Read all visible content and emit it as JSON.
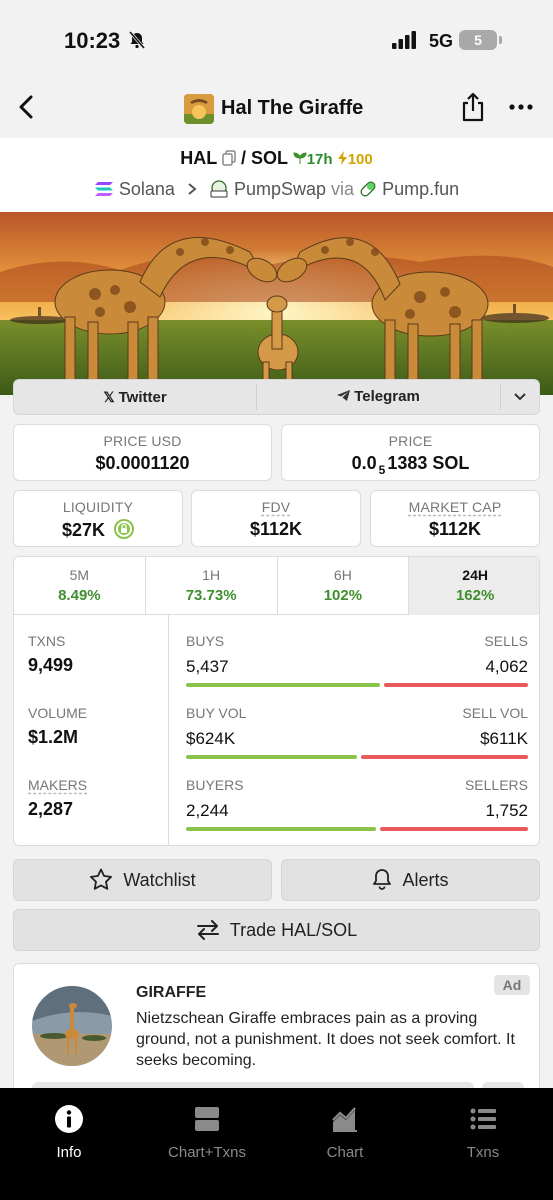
{
  "status_bar": {
    "time": "10:23",
    "network": "5G",
    "battery": "5"
  },
  "nav": {
    "title": "Hal The Giraffe"
  },
  "pair": {
    "base": "HAL",
    "separator": "/",
    "quote": "SOL",
    "age": "17h",
    "boosts": "100",
    "chain": "Solana",
    "dex": "PumpSwap",
    "via": "via",
    "launchpad": "Pump.fun"
  },
  "socials": {
    "twitter": "Twitter",
    "telegram": "Telegram"
  },
  "price_usd": {
    "label": "PRICE USD",
    "value": "$0.0001120"
  },
  "price_native": {
    "label": "PRICE",
    "prefix": "0.0",
    "zeros": "5",
    "digits": "1383 SOL"
  },
  "liquidity": {
    "label": "LIQUIDITY",
    "value": "$27K"
  },
  "fdv": {
    "label": "FDV",
    "value": "$112K"
  },
  "market_cap": {
    "label": "MARKET CAP",
    "value": "$112K"
  },
  "timeframes": [
    {
      "label": "5M",
      "change": "8.49%"
    },
    {
      "label": "1H",
      "change": "73.73%"
    },
    {
      "label": "6H",
      "change": "102%"
    },
    {
      "label": "24H",
      "change": "162%"
    }
  ],
  "selected_timeframe": "24H",
  "stats": {
    "txns": {
      "label": "TXNS",
      "value": "9,499"
    },
    "volume": {
      "label": "VOLUME",
      "value": "$1.2M"
    },
    "makers": {
      "label": "MAKERS",
      "value": "2,287"
    }
  },
  "ratios": {
    "buys_sells": {
      "left_label": "BUYS",
      "right_label": "SELLS",
      "left_value": "5,437",
      "right_value": "4,062",
      "buy_fraction": 0.572
    },
    "buy_sell_vol": {
      "left_label": "BUY VOL",
      "right_label": "SELL VOL",
      "left_value": "$624K",
      "right_value": "$611K",
      "buy_fraction": 0.505
    },
    "buyers_sellers": {
      "left_label": "BUYERS",
      "right_label": "SELLERS",
      "left_value": "2,244",
      "right_value": "1,752",
      "buy_fraction": 0.562
    }
  },
  "actions": {
    "watchlist": "Watchlist",
    "alerts": "Alerts",
    "trade": "Trade HAL/SOL"
  },
  "ad": {
    "badge": "Ad",
    "title": "GIRAFFE",
    "text": "Nietzschean Giraffe embraces pain as a proving ground, not a punishment. It does not seek comfort. It seeks becoming."
  },
  "bottom_nav": [
    {
      "label": "Info",
      "icon": "info-icon"
    },
    {
      "label": "Chart+Txns",
      "icon": "chart-txns-icon"
    },
    {
      "label": "Chart",
      "icon": "chart-icon"
    },
    {
      "label": "Txns",
      "icon": "list-icon"
    }
  ],
  "colors": {
    "positive": "#3f8f2f",
    "buy_bar": "#8ac34a",
    "sell_bar": "#e95a5a",
    "nav_bg": "#000000"
  }
}
